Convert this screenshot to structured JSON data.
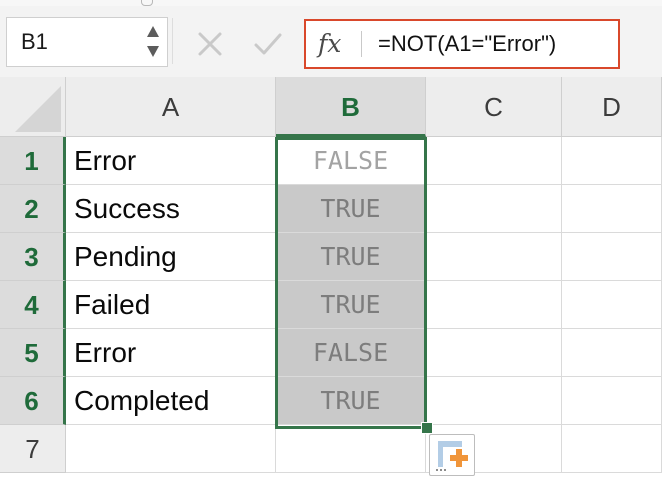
{
  "name_box": {
    "value": "B1"
  },
  "formula_bar": {
    "fx_label": "fx",
    "formula": "=NOT(A1=\"Error\")",
    "highlight_color": "#d9482b"
  },
  "columns": [
    {
      "label": "A",
      "selected": false
    },
    {
      "label": "B",
      "selected": true
    },
    {
      "label": "C",
      "selected": false
    },
    {
      "label": "D",
      "selected": false
    }
  ],
  "rows": [
    {
      "label": "1",
      "a": "Error",
      "b": "FALSE"
    },
    {
      "label": "2",
      "a": "Success",
      "b": "TRUE"
    },
    {
      "label": "3",
      "a": "Pending",
      "b": "TRUE"
    },
    {
      "label": "4",
      "a": "Failed",
      "b": "TRUE"
    },
    {
      "label": "5",
      "a": "Error",
      "b": "FALSE"
    },
    {
      "label": "6",
      "a": "Completed",
      "b": "TRUE"
    },
    {
      "label": "7",
      "a": "",
      "b": ""
    }
  ],
  "selection": {
    "range": "B1:B6",
    "color": "#35754a"
  },
  "icons": {
    "cancel": "close-icon",
    "enter": "checkmark-icon",
    "quick_analysis": "quick-analysis-icon"
  }
}
